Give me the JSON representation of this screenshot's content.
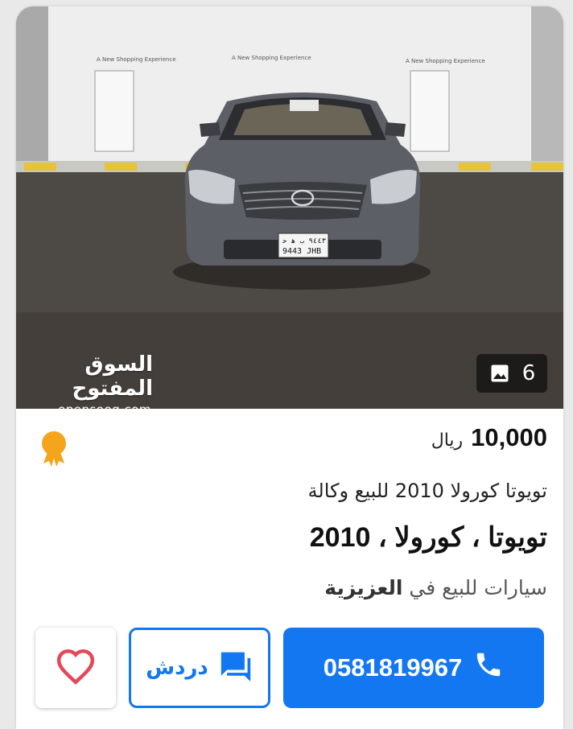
{
  "listing": {
    "photo_count": "6",
    "photo_count_icon": "image-icon",
    "watermark_arabic": "السوق المفتوح",
    "watermark_latin": "opensooq.com",
    "price_value": "10,000",
    "price_currency": "ريال",
    "badge_icon": "award-medal-icon",
    "title": "تويوتا كورولا 2010 للبيع وكالة",
    "specs": "تويوتا ، كورولا ، 2010",
    "location_prefix": "سيارات للبيع في",
    "location_city": "العزيزية"
  },
  "actions": {
    "call_label": "0581819967",
    "call_icon": "phone-icon",
    "chat_label": "دردش",
    "chat_icon": "chat-bubble-icon",
    "favorite_icon": "heart-outline-icon"
  },
  "colors": {
    "accent": "#1277f0",
    "badge": "#f4a51c",
    "heart": "#e4495a"
  }
}
